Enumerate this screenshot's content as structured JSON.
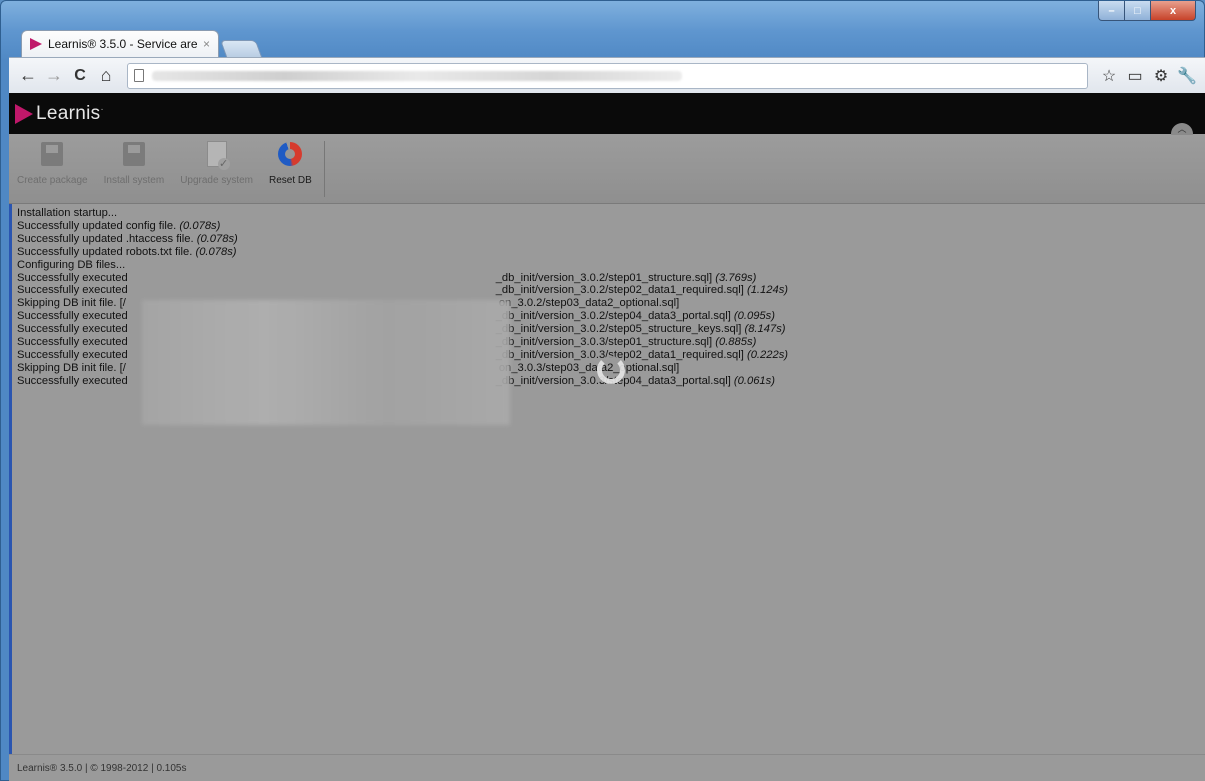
{
  "window": {
    "controls": {
      "minimize": "–",
      "maximize": "□",
      "close": "x"
    }
  },
  "tab": {
    "title": "Learnis® 3.5.0 - Service are",
    "close": "×"
  },
  "nav": {
    "back": "←",
    "forward": "→",
    "reload": "C",
    "home": "⌂"
  },
  "brand": {
    "name": "Learnis",
    "mark": "·"
  },
  "toolbar": {
    "buttons": [
      {
        "label": "Create package"
      },
      {
        "label": "Install system"
      },
      {
        "label": "Upgrade system"
      },
      {
        "label": "Reset DB"
      }
    ]
  },
  "log": {
    "lines": [
      {
        "text": "Installation startup...",
        "time": ""
      },
      {
        "text": "Successfully updated config file.",
        "time": "(0.078s)"
      },
      {
        "text": "Successfully updated .htaccess file.",
        "time": "(0.078s)"
      },
      {
        "text": "Successfully updated robots.txt file.",
        "time": "(0.078s)"
      },
      {
        "text": "Configuring DB files...",
        "time": ""
      },
      {
        "text": "Successfully executed",
        "suffix": "_db_init/version_3.0.2/step01_structure.sql]",
        "time": "(3.769s)"
      },
      {
        "text": "Successfully executed",
        "suffix": "_db_init/version_3.0.2/step02_data1_required.sql]",
        "time": "(1.124s)"
      },
      {
        "text": "Skipping DB init file. [/",
        "suffix": "on_3.0.2/step03_data2_optional.sql]",
        "time": ""
      },
      {
        "text": "Successfully executed",
        "suffix": "_db_init/version_3.0.2/step04_data3_portal.sql]",
        "time": "(0.095s)"
      },
      {
        "text": "Successfully executed",
        "suffix": "_db_init/version_3.0.2/step05_structure_keys.sql]",
        "time": "(8.147s)"
      },
      {
        "text": "Successfully executed",
        "suffix": "_db_init/version_3.0.3/step01_structure.sql]",
        "time": "(0.885s)"
      },
      {
        "text": "Successfully executed",
        "suffix": "_db_init/version_3.0.3/step02_data1_required.sql]",
        "time": "(0.222s)"
      },
      {
        "text": "Skipping DB init file. [/",
        "suffix": "on_3.0.3/step03_data2_optional.sql]",
        "time": ""
      },
      {
        "text": "Successfully executed",
        "suffix": "_db_init/version_3.0.3/step04_data3_portal.sql]",
        "time": "(0.061s)"
      }
    ]
  },
  "footer": {
    "text": "Learnis® 3.5.0 | © 1998-2012 | 0.105s"
  }
}
